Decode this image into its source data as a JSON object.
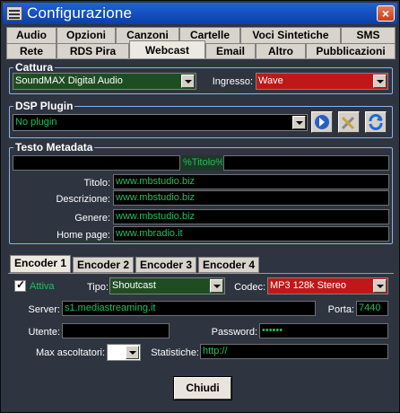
{
  "window": {
    "title": "Configurazione",
    "close_label": "×"
  },
  "tabs_row1": [
    "Audio",
    "Opzioni",
    "Canzoni",
    "Cartelle",
    "Voci Sintetiche",
    "SMS"
  ],
  "tabs_row2": [
    "Rete",
    "RDS Pira",
    "Webcast",
    "Email",
    "Altro",
    "Pubblicazioni"
  ],
  "active_tab": "Webcast",
  "cattura": {
    "label": "Cattura",
    "device": "SoundMAX Digital Audio",
    "ingresso_label": "Ingresso:",
    "ingresso": "Wave"
  },
  "dsp": {
    "label": "DSP Plugin",
    "plugin": "No plugin",
    "buttons": [
      "plugin-config-icon",
      "tools-icon",
      "refresh-icon"
    ]
  },
  "metadata": {
    "label": "Testo Metadata",
    "prefix": "",
    "token": "%Titolo%",
    "suffix": "",
    "titolo_label": "Titolo:",
    "titolo": "www.mbstudio.biz",
    "descrizione_label": "Descrizione:",
    "descrizione": "www.mbstudio.biz",
    "genere_label": "Genere:",
    "genere": "www.mbstudio.biz",
    "homepage_label": "Home page:",
    "homepage": "www.mbradio.it"
  },
  "encoder_tabs": [
    "Encoder 1",
    "Encoder 2",
    "Encoder 3",
    "Encoder 4"
  ],
  "encoder": {
    "attiva_label": "Attiva",
    "attiva": true,
    "tipo_label": "Tipo:",
    "tipo": "Shoutcast",
    "codec_label": "Codec:",
    "codec": "MP3 128k Stereo",
    "server_label": "Server:",
    "server": "s1.mediastreaming.it",
    "porta_label": "Porta:",
    "porta": "7440",
    "utente_label": "Utente:",
    "utente": "",
    "password_label": "Password:",
    "password": "••••••",
    "max_label": "Max ascoltatori:",
    "max": "",
    "stat_label": "Statistiche:",
    "stat": "http://"
  },
  "close_button": "Chiudi",
  "colors": {
    "bg": "#2e3440",
    "title": "#0b3fa8",
    "field_text": "#19c25a",
    "combo_red": "#c01818",
    "combo_green": "#1e4d22"
  }
}
